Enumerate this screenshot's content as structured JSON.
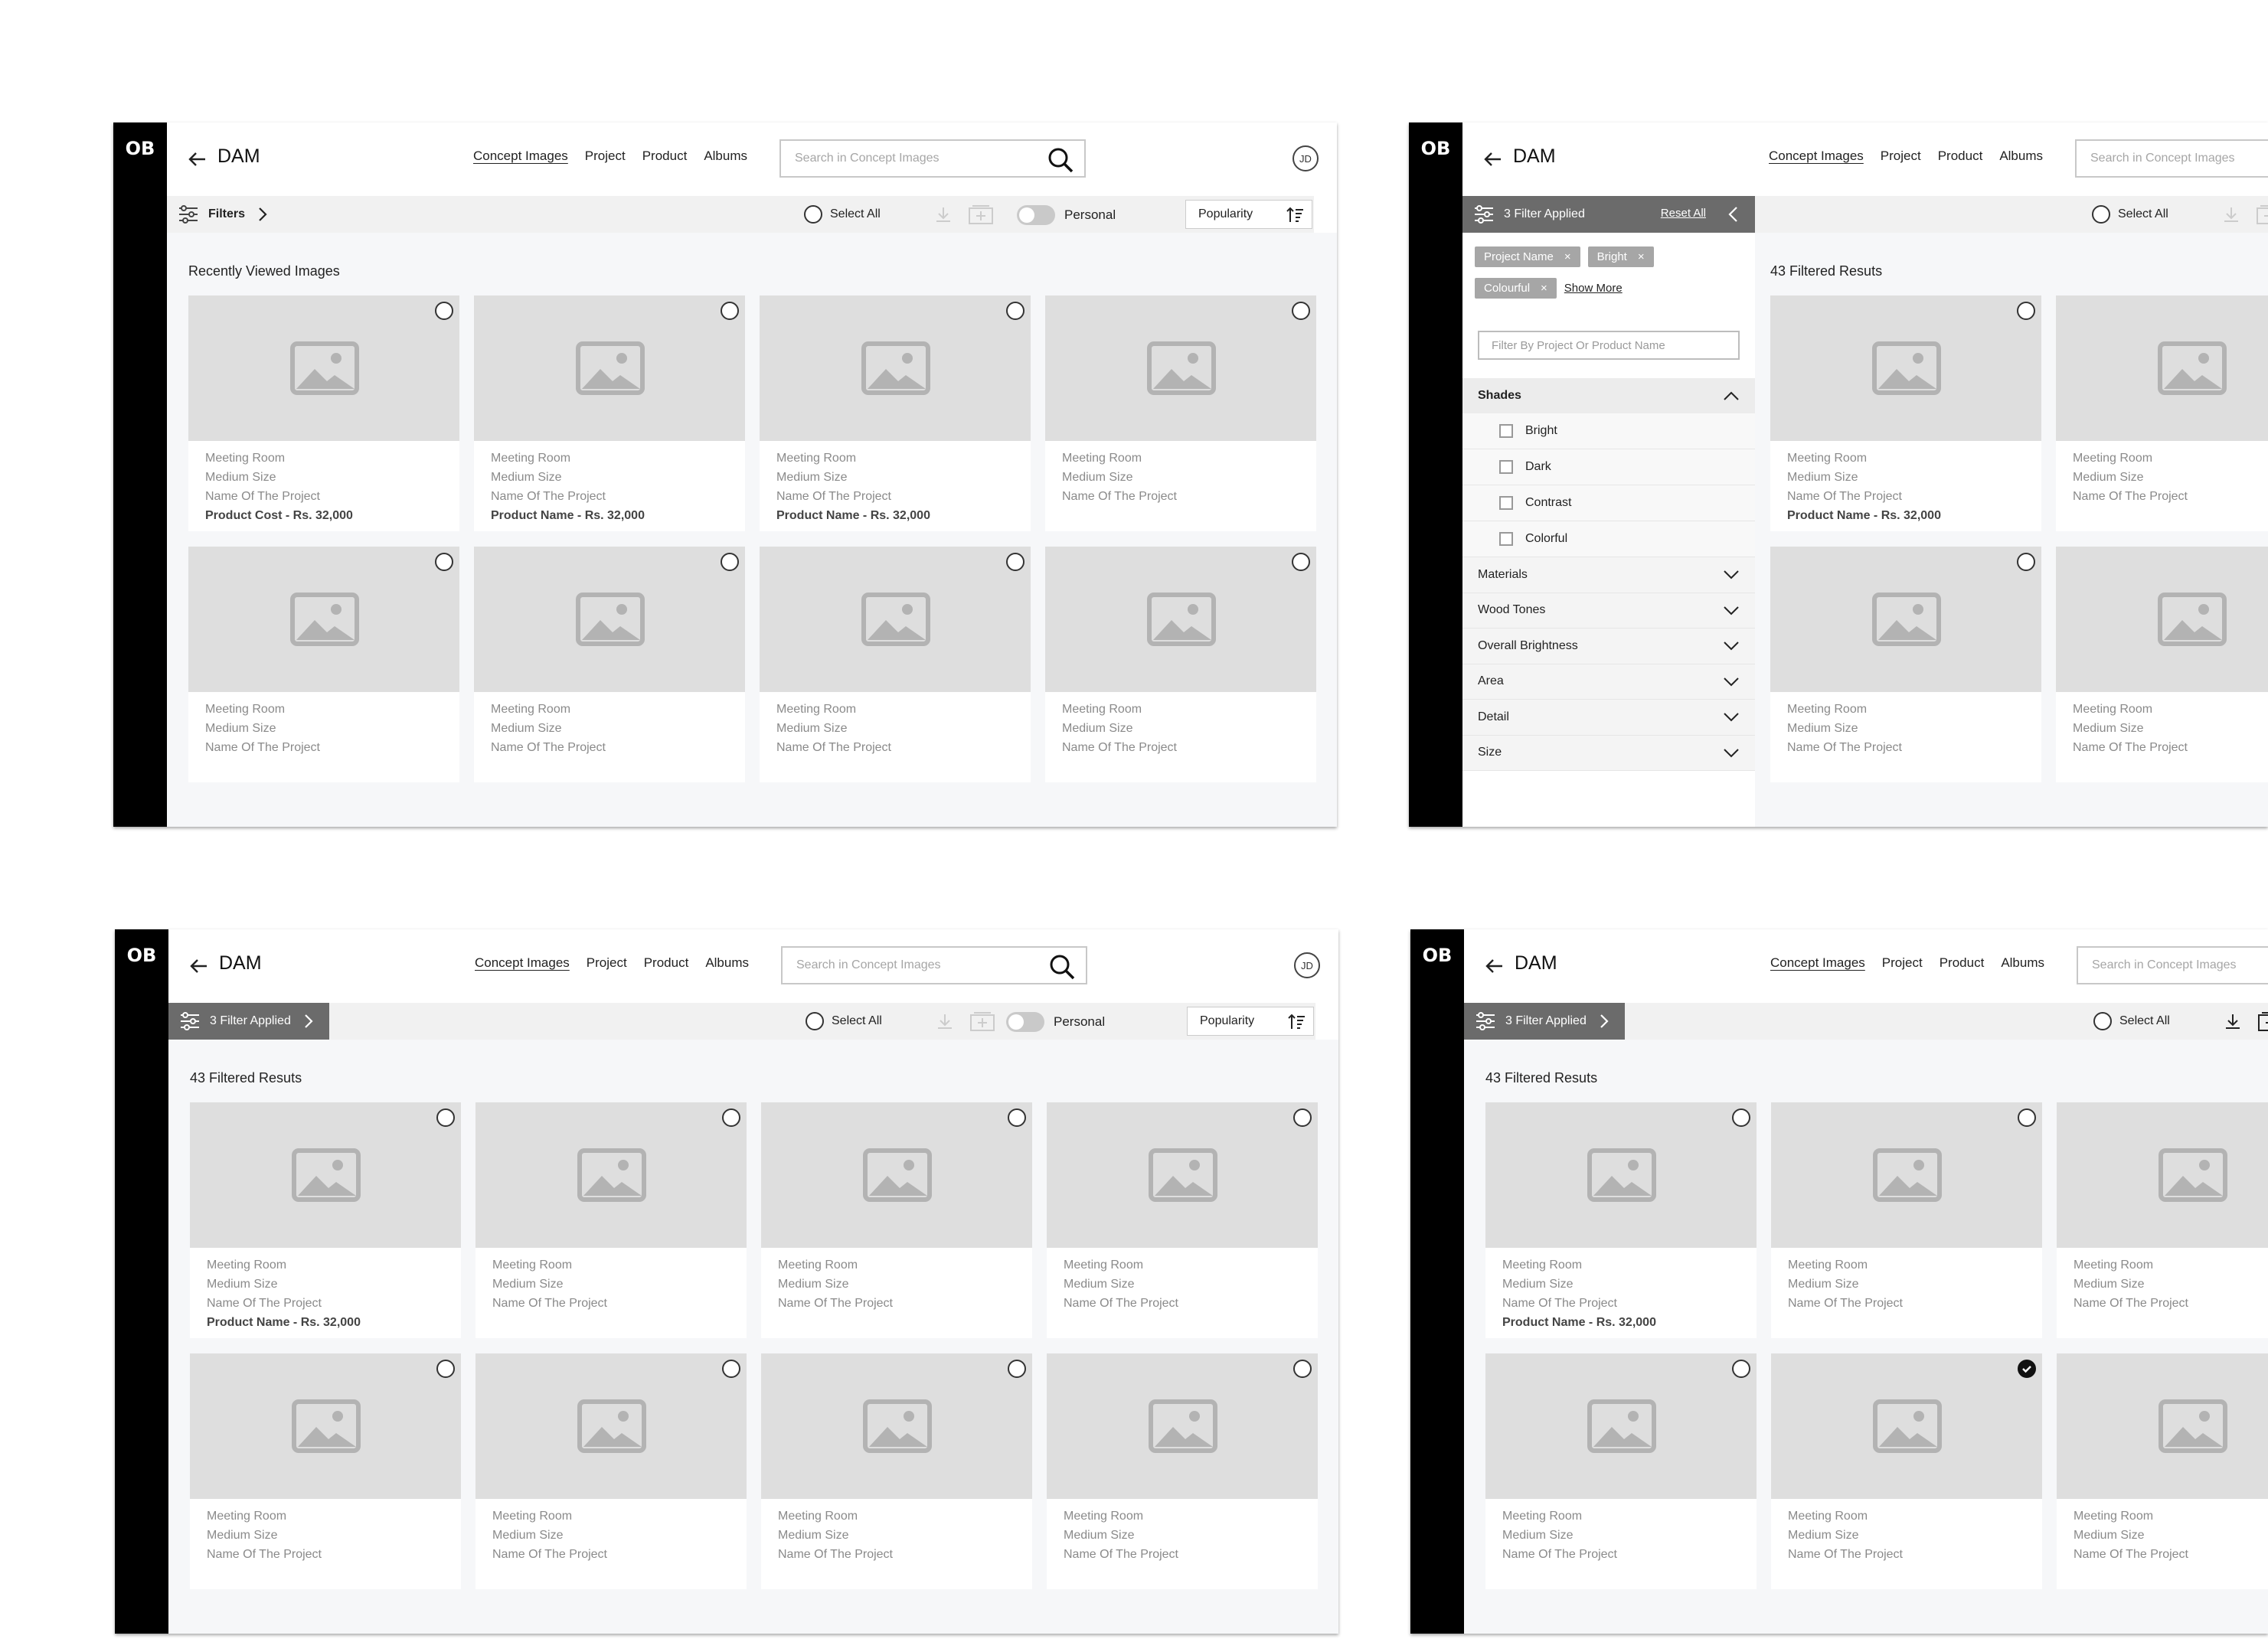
{
  "brand": {
    "logo": "OB",
    "app": "DAM"
  },
  "nav": [
    "Concept Images",
    "Project",
    "Product",
    "Albums"
  ],
  "search_placeholder": "Search in Concept Images",
  "avatar": "JD",
  "toolbar": {
    "filters_label": "Filters",
    "filters_applied_label": "3 Filter Applied",
    "select_all": "Select All",
    "personal": "Personal",
    "sort": "Popularity"
  },
  "filter_panel": {
    "reset": "Reset All",
    "chips": [
      "Project Name",
      "Bright",
      "Colourful"
    ],
    "show_more": "Show More",
    "input_placeholder": "Filter By Project Or Product Name",
    "shades_title": "Shades",
    "shades": [
      "Bright",
      "Dark",
      "Contrast",
      "Colorful"
    ],
    "facets": [
      "Materials",
      "Wood Tones",
      "Overall Brightness",
      "Area",
      "Detail",
      "Size"
    ]
  },
  "screens": [
    {
      "title": "Recently Viewed Images",
      "cards": [
        {
          "l1": "Meeting Room",
          "l2": "Medium Size",
          "l3": "Name Of The Project",
          "l4": "Product Cost - Rs. 32,000"
        },
        {
          "l1": "Meeting Room",
          "l2": "Medium Size",
          "l3": "Name Of The Project",
          "l4": "Product Name - Rs. 32,000"
        },
        {
          "l1": "Meeting Room",
          "l2": "Medium Size",
          "l3": "Name Of The Project",
          "l4": "Product Name - Rs. 32,000"
        },
        {
          "l1": "Meeting Room",
          "l2": "Medium Size",
          "l3": "Name Of The Project",
          "l4": ""
        },
        {
          "l1": "Meeting Room",
          "l2": "Medium Size",
          "l3": "Name Of The Project",
          "l4": ""
        },
        {
          "l1": "Meeting Room",
          "l2": "Medium Size",
          "l3": "Name Of The Project",
          "l4": ""
        },
        {
          "l1": "Meeting Room",
          "l2": "Medium Size",
          "l3": "Name Of The Project",
          "l4": ""
        },
        {
          "l1": "Meeting Room",
          "l2": "Medium Size",
          "l3": "Name Of The Project",
          "l4": ""
        }
      ]
    },
    {
      "title": "43 Filtered Resuts",
      "cards": [
        {
          "l1": "Meeting Room",
          "l2": "Medium Size",
          "l3": "Name Of The Project",
          "l4": "Product Name - Rs. 32,000"
        },
        {
          "l1": "Meeting Room",
          "l2": "Medium Size",
          "l3": "Name Of The Project",
          "l4": ""
        },
        {
          "l1": "Meeting Room",
          "l2": "Medium Size",
          "l3": "Name Of The Project",
          "l4": ""
        },
        {
          "l1": "Meeting Room",
          "l2": "Medium Size",
          "l3": "Name Of The Project",
          "l4": ""
        }
      ]
    },
    {
      "title": "43 Filtered Resuts",
      "cards": [
        {
          "l1": "Meeting Room",
          "l2": "Medium Size",
          "l3": "Name Of The Project",
          "l4": "Product Name - Rs. 32,000"
        },
        {
          "l1": "Meeting Room",
          "l2": "Medium Size",
          "l3": "Name Of The Project",
          "l4": ""
        },
        {
          "l1": "Meeting Room",
          "l2": "Medium Size",
          "l3": "Name Of The Project",
          "l4": ""
        },
        {
          "l1": "Meeting Room",
          "l2": "Medium Size",
          "l3": "Name Of The Project",
          "l4": ""
        },
        {
          "l1": "Meeting Room",
          "l2": "Medium Size",
          "l3": "Name Of The Project",
          "l4": ""
        },
        {
          "l1": "Meeting Room",
          "l2": "Medium Size",
          "l3": "Name Of The Project",
          "l4": ""
        },
        {
          "l1": "Meeting Room",
          "l2": "Medium Size",
          "l3": "Name Of The Project",
          "l4": ""
        },
        {
          "l1": "Meeting Room",
          "l2": "Medium Size",
          "l3": "Name Of The Project",
          "l4": ""
        }
      ]
    },
    {
      "title": "43 Filtered Resuts",
      "cards": [
        {
          "l1": "Meeting Room",
          "l2": "Medium Size",
          "l3": "Name Of The Project",
          "l4": "Product Name - Rs. 32,000",
          "checked": false
        },
        {
          "l1": "Meeting Room",
          "l2": "Medium Size",
          "l3": "Name Of The Project",
          "l4": "",
          "checked": false
        },
        {
          "l1": "Meeting Room",
          "l2": "Medium Size",
          "l3": "Name Of The Project",
          "l4": "",
          "checked": false
        },
        {
          "l1": "Meeting Room",
          "l2": "Medium Size",
          "l3": "Name Of The Project",
          "l4": "",
          "checked": false
        },
        {
          "l1": "Meeting Room",
          "l2": "Medium Size",
          "l3": "Name Of The Project",
          "l4": "",
          "checked": true
        },
        {
          "l1": "Meeting Room",
          "l2": "Medium Size",
          "l3": "Name Of The Project",
          "l4": "",
          "checked": false
        }
      ]
    }
  ],
  "colors": {
    "accent": "#000000",
    "panel_header": "#6b6b6b",
    "chip": "#a6a6a6",
    "thumb": "#dedede"
  }
}
